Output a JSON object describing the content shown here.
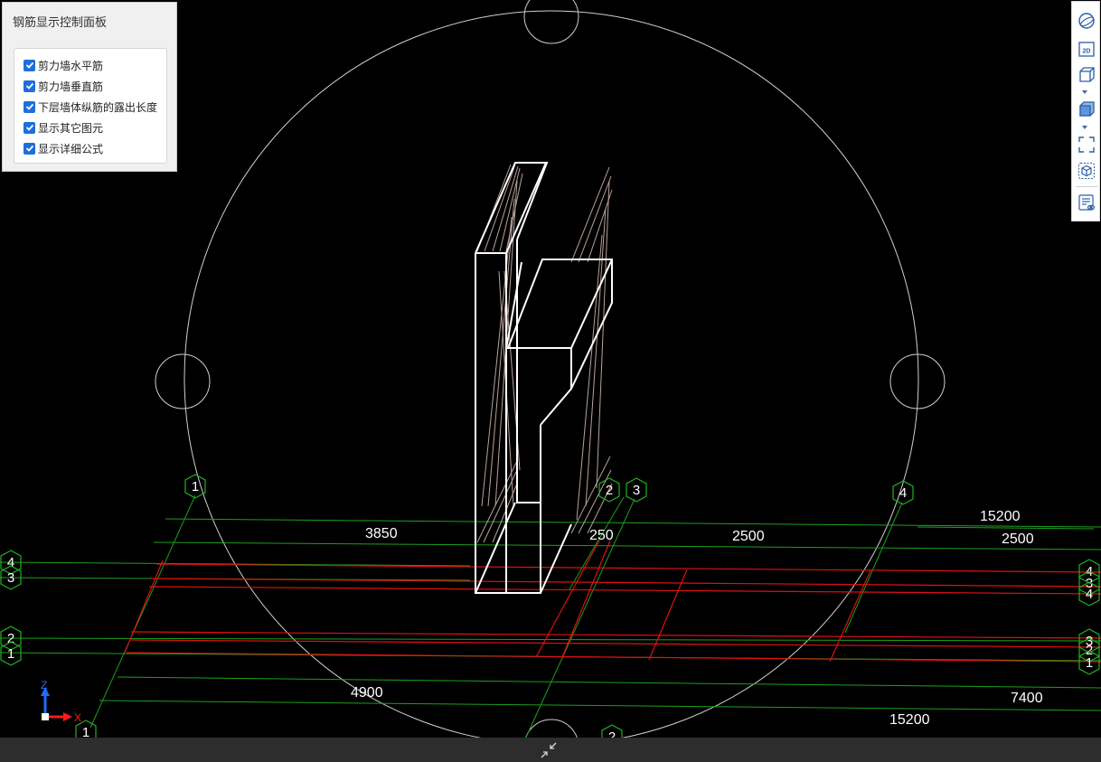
{
  "panel": {
    "title": "钢筋显示控制面板",
    "options": [
      {
        "label": "剪力墙水平筋",
        "checked": true
      },
      {
        "label": "剪力墙垂直筋",
        "checked": true
      },
      {
        "label": "下层墙体纵筋的露出长度",
        "checked": true
      },
      {
        "label": "显示其它图元",
        "checked": true
      },
      {
        "label": "显示详细公式",
        "checked": true
      }
    ]
  },
  "toolbar": {
    "icons": [
      "orbit-icon",
      "view-2d-icon",
      "view-cube-icon",
      "shaded-cube-icon",
      "fit-view-icon",
      "select-cube-icon",
      "properties-icon"
    ],
    "view_2d_label": "2D"
  },
  "dimensions": {
    "top_left": "3850",
    "top_mid_small": "250",
    "top_mid": "2500",
    "top_right": "2500",
    "top_total": "15200",
    "bottom_left": "4900",
    "bottom_right": "7400",
    "bottom_total": "15200"
  },
  "axis_bubbles": {
    "top_1": "1",
    "top_2": "2",
    "top_3": "3",
    "top_4": "4",
    "bottom_1": "1",
    "bottom_2": "2",
    "left_4": "4",
    "left_3": "3",
    "left_2": "2",
    "left_1": "1",
    "right_4a": "4",
    "right_3": "3",
    "right_4b": "4",
    "right_3b": "3",
    "right_2": "2",
    "right_1": "1"
  },
  "triad": {
    "z": "Z",
    "x": "X"
  },
  "colors": {
    "grid": "#1ba01b",
    "red": "#e01010",
    "wall": "#ffffff",
    "rebar": "#b8a29a",
    "bubble": "#1fb51f",
    "circle": "#cfcfcf"
  }
}
